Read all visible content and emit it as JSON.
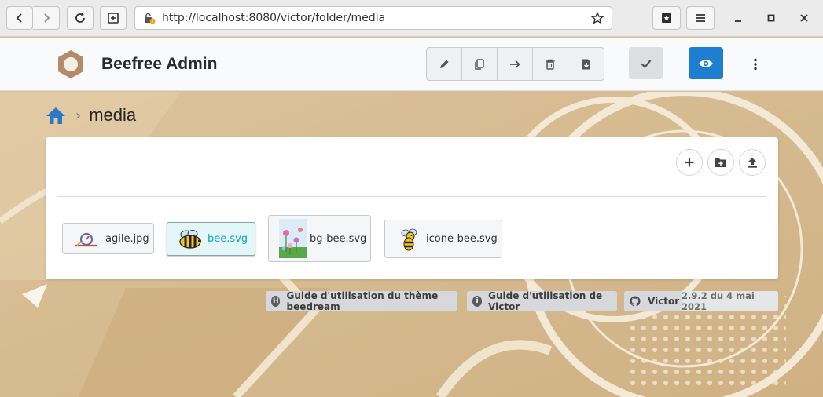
{
  "browser": {
    "url": "http://localhost:8080/victor/folder/media"
  },
  "header": {
    "app_title": "Beefree Admin",
    "accent_color": "#1f7ed0"
  },
  "breadcrumb": {
    "current": "media"
  },
  "files": [
    {
      "name": "agile.jpg",
      "selected": false
    },
    {
      "name": "bee.svg",
      "selected": true
    },
    {
      "name": "bg-bee.svg",
      "selected": false
    },
    {
      "name": "icone-bee.svg",
      "selected": false
    }
  ],
  "footer": {
    "theme_guide": "Guide d'utilisation du thème beedream",
    "victor_guide": "Guide d'utilisation de Victor",
    "github_label": "Victor",
    "version": "2.9.2 du 4 mai 2021"
  }
}
